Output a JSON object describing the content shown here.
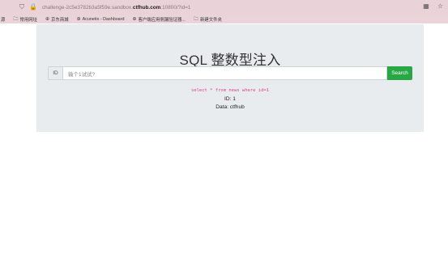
{
  "browser": {
    "url_prefix": "challenge-2c5e3782b3a5f59e.sandbox.",
    "url_host": "ctfhub.com",
    "url_suffix": ":10800/?id=1",
    "bookmarks": [
      {
        "label": "常用网址",
        "icon": "folder-icon"
      },
      {
        "label": "京东商城",
        "icon": "globe-icon"
      },
      {
        "label": "Acunetix - Dashboard",
        "icon": "globe-icon"
      },
      {
        "label": "客户端应用侧漏验证器...",
        "icon": "globe-icon"
      },
      {
        "label": "新建文件夹",
        "icon": "folder-icon"
      }
    ],
    "left_cut_label": "源"
  },
  "page": {
    "title": "SQL 整数型注入",
    "id_label": "ID",
    "input_placeholder": "输个1试试?",
    "search_label": "Search",
    "query_text": "select * from news where id=1",
    "result_id": "ID: 1",
    "result_data": "Data: ctfhub"
  },
  "colors": {
    "chrome": "#ead3d8",
    "jumbotron": "#e9ecef",
    "search_button": "#28a745",
    "query_text": "#e83e8c"
  }
}
